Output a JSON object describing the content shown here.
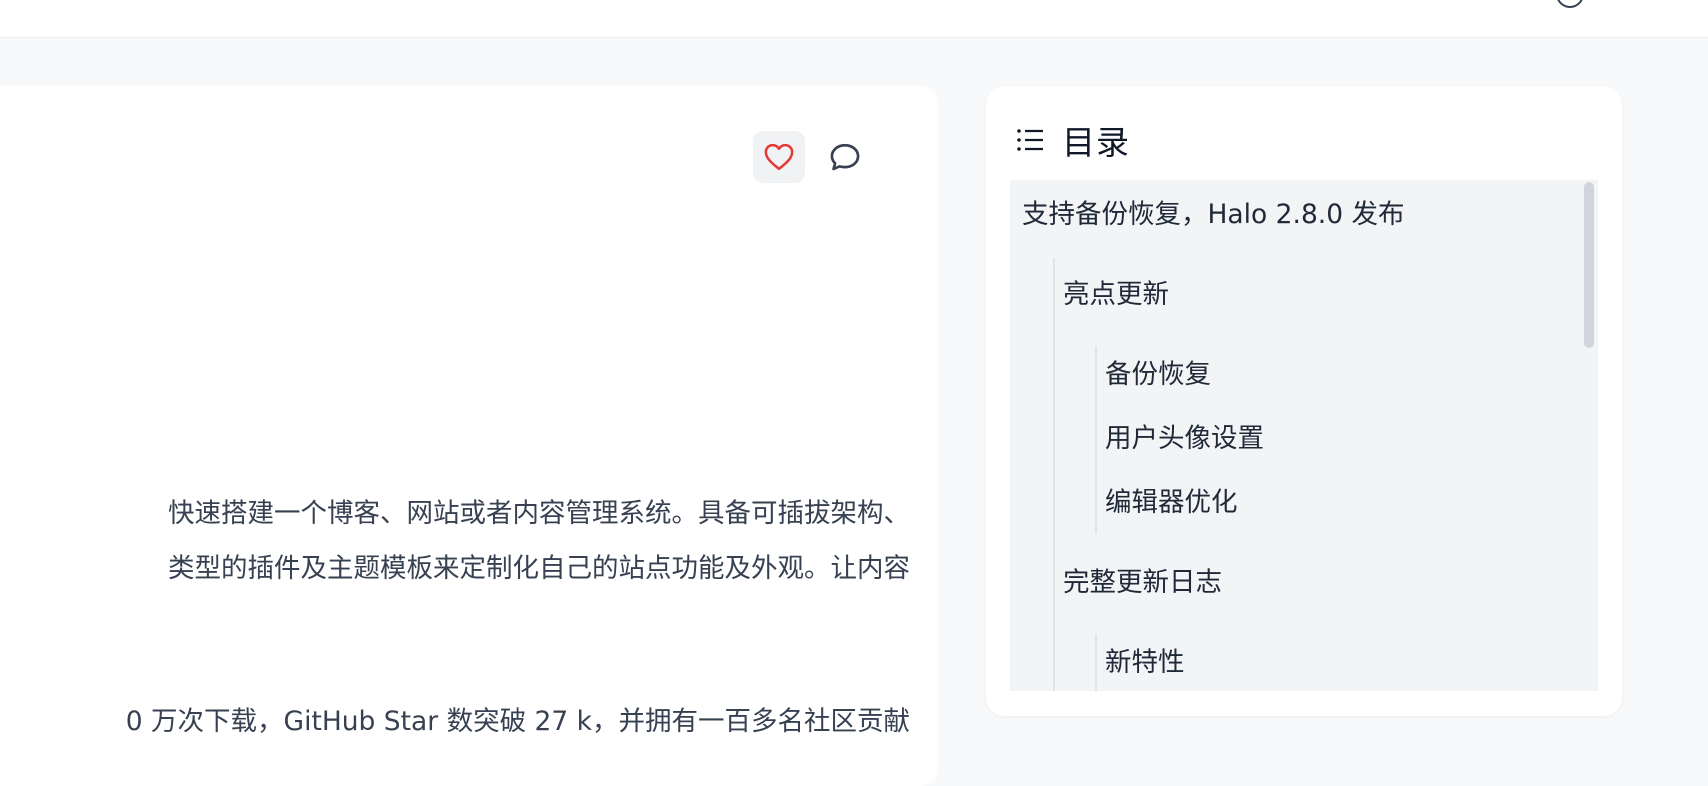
{
  "article": {
    "paragraph1": {
      "line1": "快速搭建一个博客、网站或者内容管理系统。具备可插拔架构、",
      "line2": "类型的插件及主题模板来定制化自己的站点功能及外观。让内容"
    },
    "paragraph2": {
      "line1": "0 万次下载，GitHub Star 数突破 27 k，并拥有一百多名社区贡献"
    },
    "actions": {
      "like_icon": "heart-icon",
      "like_color": "#e53935",
      "comment_icon": "comment-icon"
    }
  },
  "toc": {
    "title": "目录",
    "title_icon": "list-icon",
    "items": [
      {
        "label": "支持备份恢复，Halo 2.8.0 发布",
        "level": 1
      },
      {
        "label": "亮点更新",
        "level": 2
      },
      {
        "label": "备份恢复",
        "level": 3
      },
      {
        "label": "用户头像设置",
        "level": 3
      },
      {
        "label": "编辑器优化",
        "level": 3
      },
      {
        "label": "完整更新日志",
        "level": 2
      },
      {
        "label": "新特性",
        "level": 3
      }
    ]
  },
  "colors": {
    "page_background": "#f8f9fa",
    "card_background": "#ffffff",
    "toc_active_background": "#f3f4f6",
    "like_red": "#e53935"
  }
}
